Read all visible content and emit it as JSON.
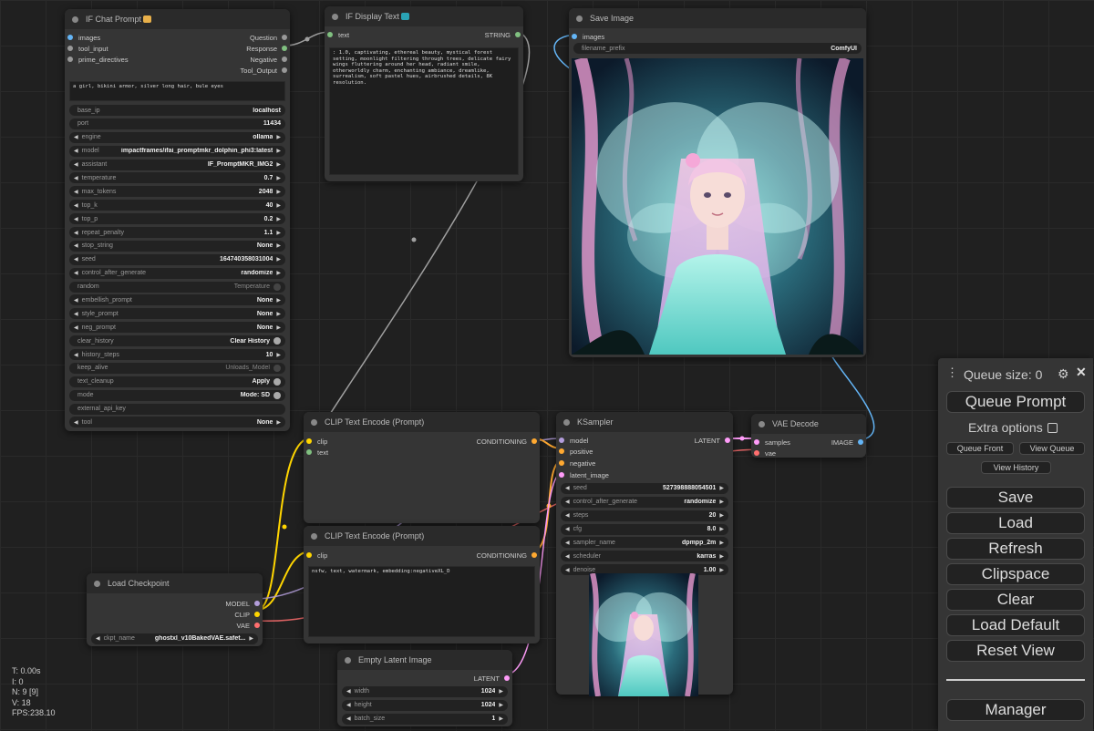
{
  "nodes": {
    "chat": {
      "title": "IF Chat Prompt",
      "inputs": [
        "images",
        "tool_input",
        "prime_directives"
      ],
      "outputs": [
        "Question",
        "Response",
        "Negative",
        "Tool_Output"
      ],
      "text": "a girl, bikini armor, silver long hair, bule eyes",
      "widgets": [
        {
          "label": "base_ip",
          "value": "localhost"
        },
        {
          "label": "port",
          "value": "11434"
        },
        {
          "label": "engine",
          "value": "ollama"
        },
        {
          "label": "model",
          "value": "impactframes/ifai_promptmkr_dolphin_phi3:latest"
        },
        {
          "label": "assistant",
          "value": "IF_PromptMKR_IMG2"
        },
        {
          "label": "temperature",
          "value": "0.7"
        },
        {
          "label": "max_tokens",
          "value": "2048"
        },
        {
          "label": "top_k",
          "value": "40"
        },
        {
          "label": "top_p",
          "value": "0.2"
        },
        {
          "label": "repeat_penalty",
          "value": "1.1"
        },
        {
          "label": "stop_string",
          "value": "None"
        },
        {
          "label": "seed",
          "value": "164740358031004"
        },
        {
          "label": "control_after_generate",
          "value": "randomize"
        },
        {
          "label": "random",
          "value": "Temperature"
        },
        {
          "label": "embellish_prompt",
          "value": "None"
        },
        {
          "label": "style_prompt",
          "value": "None"
        },
        {
          "label": "neg_prompt",
          "value": "None"
        },
        {
          "label": "clear_history",
          "value": "Clear History"
        },
        {
          "label": "history_steps",
          "value": "10"
        },
        {
          "label": "keep_alive",
          "value": "Unloads_Model"
        },
        {
          "label": "text_cleanup",
          "value": "Apply"
        },
        {
          "label": "mode",
          "value": "Mode: SD"
        },
        {
          "label": "external_api_key",
          "value": ""
        },
        {
          "label": "tool",
          "value": "None"
        }
      ]
    },
    "display": {
      "title": "IF Display Text",
      "input": "text",
      "output": "STRING",
      "text": ": 1.0, captivating, ethereal beauty, mystical forest setting, moonlight filtering through trees, delicate fairy wings fluttering around her head, radiant smile, otherworldly charm, enchanting ambiance, dreamlike, surrealism, soft pastel hues, airbrushed details, 8K resolution."
    },
    "save": {
      "title": "Save Image",
      "input": "images",
      "widget": {
        "label": "filename_prefix",
        "value": "ComfyUI"
      }
    },
    "clip1": {
      "title": "CLIP Text Encode (Prompt)",
      "inputs": [
        "clip",
        "text"
      ],
      "output": "CONDITIONING"
    },
    "clip2": {
      "title": "CLIP Text Encode (Prompt)",
      "input": "clip",
      "output": "CONDITIONING",
      "text": "nsfw, text, watermark, embedding:negativeXL_D"
    },
    "ksampler": {
      "title": "KSampler",
      "inputs": [
        "model",
        "positive",
        "negative",
        "latent_image"
      ],
      "output": "LATENT",
      "widgets": [
        {
          "label": "seed",
          "value": "527398888054501"
        },
        {
          "label": "control_after_generate",
          "value": "randomize"
        },
        {
          "label": "steps",
          "value": "20"
        },
        {
          "label": "cfg",
          "value": "8.0"
        },
        {
          "label": "sampler_name",
          "value": "dpmpp_2m"
        },
        {
          "label": "scheduler",
          "value": "karras"
        },
        {
          "label": "denoise",
          "value": "1.00"
        }
      ]
    },
    "vae": {
      "title": "VAE Decode",
      "inputs": [
        "samples",
        "vae"
      ],
      "output": "IMAGE"
    },
    "checkpoint": {
      "title": "Load Checkpoint",
      "outputs": [
        "MODEL",
        "CLIP",
        "VAE"
      ],
      "widget": {
        "label": "ckpt_name",
        "value": "ghostxl_v10BakedVAE.safet..."
      }
    },
    "latent": {
      "title": "Empty Latent Image",
      "output": "LATENT",
      "widgets": [
        {
          "label": "width",
          "value": "1024"
        },
        {
          "label": "height",
          "value": "1024"
        },
        {
          "label": "batch_size",
          "value": "1"
        }
      ]
    }
  },
  "queue": {
    "size_label": "Queue size: 0",
    "queue_prompt": "Queue Prompt",
    "extra_options": "Extra options",
    "queue_front": "Queue Front",
    "view_queue": "View Queue",
    "view_history": "View History",
    "buttons": [
      "Save",
      "Load",
      "Refresh",
      "Clipspace",
      "Clear",
      "Load Default",
      "Reset View"
    ],
    "manager": "Manager"
  },
  "stats": {
    "t": "T: 0.00s",
    "i": "I: 0",
    "n": "N: 9 [9]",
    "v": "V: 18",
    "fps": "FPS:238.10"
  },
  "colors": {
    "image": "#64b5f6",
    "string": "#80c080",
    "clip": "#ffd500",
    "model": "#b39ddb",
    "conditioning": "#ffa931",
    "latent": "#ff9cf9",
    "vae": "#ff6e6e",
    "wire_gray": "#a0a0a0"
  }
}
